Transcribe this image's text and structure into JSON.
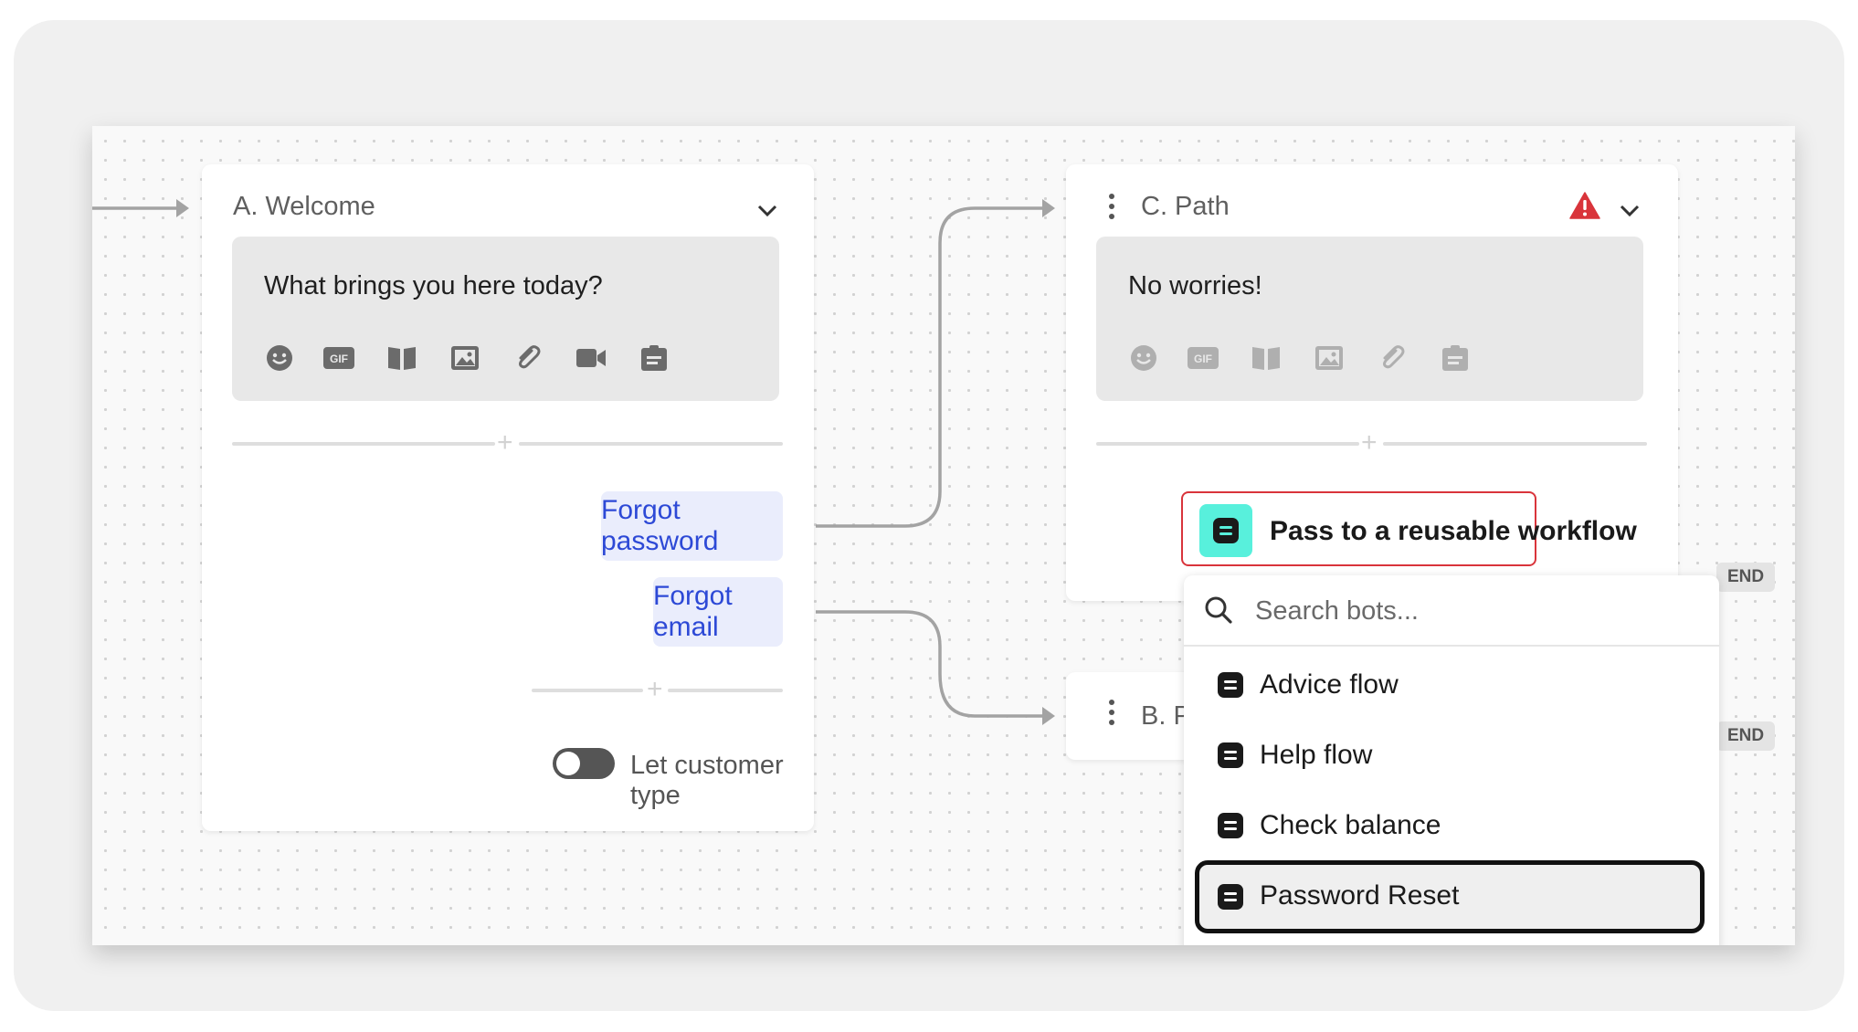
{
  "nodes": {
    "welcome": {
      "title": "A. Welcome",
      "message": "What brings you here today?",
      "tools": [
        "emoji-icon",
        "gif-icon",
        "article-icon",
        "image-icon",
        "attachment-icon",
        "video-icon",
        "form-icon"
      ],
      "replies": [
        "Forgot password",
        "Forgot email"
      ],
      "toggle_label": "Let customer type",
      "toggle_on": false
    },
    "path_c": {
      "title": "C. Path",
      "message": "No worries!",
      "tools": [
        "emoji-icon",
        "gif-icon",
        "article-icon",
        "image-icon",
        "attachment-icon",
        "form-icon"
      ],
      "status_icon": "warning-icon",
      "action": {
        "label": "Pass to a reusable workflow",
        "icon": "workflow-icon"
      }
    },
    "path_b": {
      "title": "B. P"
    }
  },
  "end_badges": [
    "END",
    "END"
  ],
  "dropdown": {
    "search_placeholder": "Search bots...",
    "items": [
      "Advice flow",
      "Help flow",
      "Check balance",
      "Password Reset"
    ],
    "selected": "Password Reset"
  },
  "colors": {
    "accent_blue": "#2d49d6",
    "reply_bg": "#eaedfc",
    "warning_red": "#d9343b",
    "workflow_teal": "#58f0dc"
  }
}
